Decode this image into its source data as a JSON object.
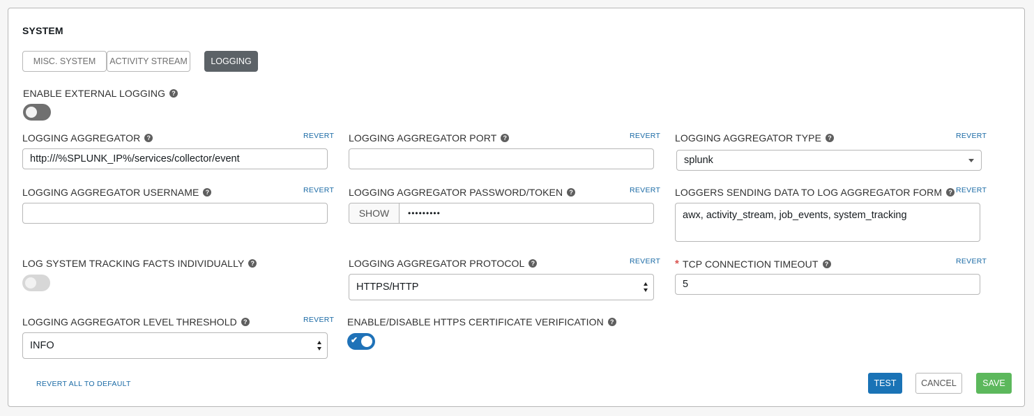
{
  "panel": {
    "title": "SYSTEM",
    "tabs": [
      {
        "label": "MISC. SYSTEM",
        "active": false
      },
      {
        "label": "ACTIVITY STREAM",
        "active": false
      },
      {
        "label": "LOGGING",
        "active": true
      }
    ]
  },
  "fields": {
    "enable_external_logging": {
      "label": "ENABLE EXTERNAL LOGGING",
      "on": false
    },
    "aggregator": {
      "label": "LOGGING AGGREGATOR",
      "value": "http:///%SPLUNK_IP%/services/collector/event"
    },
    "port": {
      "label": "LOGGING AGGREGATOR PORT",
      "value": ""
    },
    "type": {
      "label": "LOGGING AGGREGATOR TYPE",
      "value": "splunk"
    },
    "username": {
      "label": "LOGGING AGGREGATOR USERNAME",
      "value": ""
    },
    "password": {
      "label": "LOGGING AGGREGATOR PASSWORD/TOKEN",
      "show_label": "SHOW",
      "value": "•••••••••"
    },
    "loggers": {
      "label": "LOGGERS SENDING DATA TO LOG AGGREGATOR FORM",
      "value": "awx, activity_stream, job_events, system_tracking"
    },
    "individual_facts": {
      "label": "LOG SYSTEM TRACKING FACTS INDIVIDUALLY",
      "on": false
    },
    "protocol": {
      "label": "LOGGING AGGREGATOR PROTOCOL",
      "value": "HTTPS/HTTP"
    },
    "tcp_timeout": {
      "label": "TCP CONNECTION TIMEOUT",
      "required_mark": "*",
      "value": "5"
    },
    "level_threshold": {
      "label": "LOGGING AGGREGATOR LEVEL THRESHOLD",
      "value": "INFO"
    },
    "cert_verification": {
      "label": "ENABLE/DISABLE HTTPS CERTIFICATE VERIFICATION",
      "on": true
    }
  },
  "common": {
    "revert": "REVERT",
    "help_glyph": "?",
    "check_glyph": "✔"
  },
  "footer": {
    "revert_all": "REVERT ALL TO DEFAULT",
    "test": "TEST",
    "cancel": "CANCEL",
    "save": "SAVE"
  },
  "colors": {
    "primary": "#1a73b6",
    "success": "#5cb85c",
    "active_tab": "#5c6267",
    "required": "#d9534f",
    "link": "#1a6aa5"
  }
}
